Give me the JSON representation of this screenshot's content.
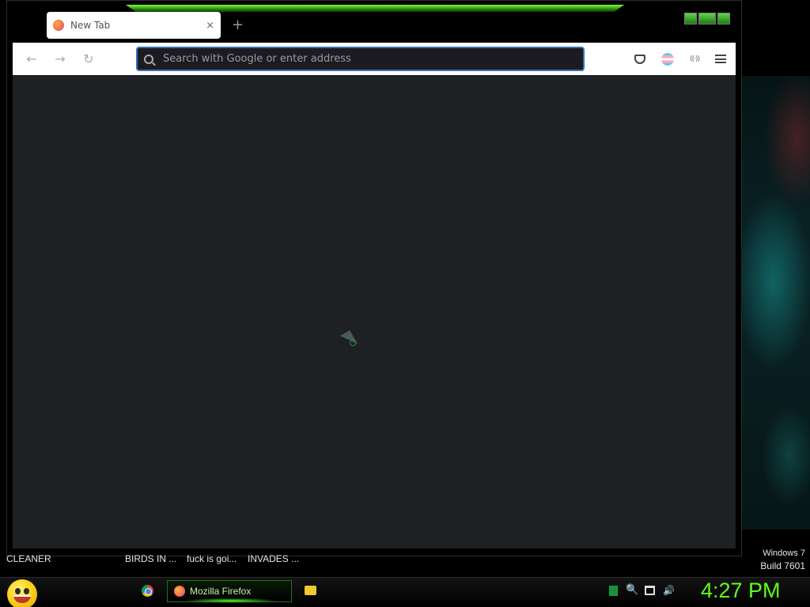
{
  "browser": {
    "tab_title": "New Tab",
    "tab_close": "×",
    "new_tab": "+",
    "url_placeholder": "Search with Google or enter address",
    "back": "←",
    "forward": "→",
    "reload": "↻",
    "extension_label": "((·))"
  },
  "desktop": {
    "icons": [
      {
        "label": "CLEANER"
      },
      {
        "label": "BIRDS IN ..."
      },
      {
        "label": "fuck is goi..."
      },
      {
        "label": "INVADES ..."
      }
    ],
    "windows_version_line1": "Windows 7",
    "windows_version_line2": "Build 7601"
  },
  "taskbar": {
    "firefox_label": "Mozilla Firefox",
    "tray_volume": "🔊",
    "tray_search": "🔍",
    "clock": "4:27 PM"
  },
  "colors": {
    "accent_green": "#5cff20",
    "url_focus": "#3b6fb6",
    "content_bg": "#1f2024"
  }
}
